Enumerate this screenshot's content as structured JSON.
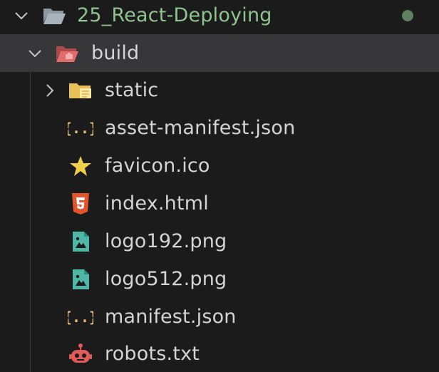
{
  "colors": {
    "background": "#1b1b1c",
    "selected_row": "#37373a",
    "root_label": "#8fc48f",
    "file_label": "#d4d4d4",
    "status_dot": "#5f7f5f",
    "json_icon": "#e5c07b",
    "star_icon": "#f0cf4a",
    "html_icon": "#e2552c",
    "image_icon": "#4fb7a6",
    "robot_icon": "#e05a5a",
    "build_folder": "#e06c6c",
    "static_folder": "#e8c05a"
  },
  "tree": {
    "root": {
      "label": "25_React-Deploying",
      "expanded": true,
      "icon": "folder-open-icon",
      "status": "modified-dot"
    },
    "build": {
      "label": "build",
      "expanded": true,
      "selected": true,
      "icon": "build-folder-open-icon"
    },
    "items": [
      {
        "label": "static",
        "type": "folder",
        "icon": "folder-icon",
        "expanded": false
      },
      {
        "label": "asset-manifest.json",
        "type": "file",
        "icon": "json-icon"
      },
      {
        "label": "favicon.ico",
        "type": "file",
        "icon": "star-icon"
      },
      {
        "label": "index.html",
        "type": "file",
        "icon": "html5-icon"
      },
      {
        "label": "logo192.png",
        "type": "file",
        "icon": "image-icon"
      },
      {
        "label": "logo512.png",
        "type": "file",
        "icon": "image-icon"
      },
      {
        "label": "manifest.json",
        "type": "file",
        "icon": "json-icon"
      },
      {
        "label": "robots.txt",
        "type": "file",
        "icon": "robot-icon"
      }
    ]
  }
}
